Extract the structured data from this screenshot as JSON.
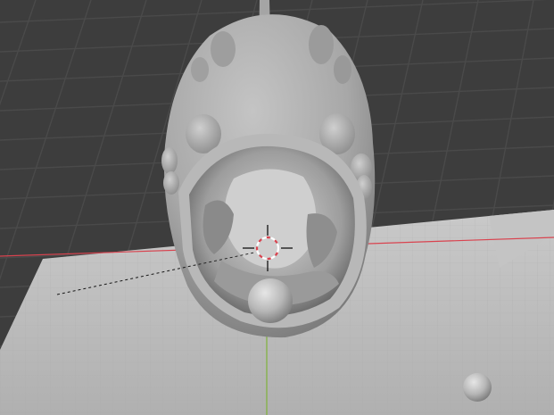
{
  "viewport": {
    "shading": "solid",
    "background_color": "#3d3d3d",
    "grid_line_color": "#4a4a4a",
    "x_axis_color": "#d9434f",
    "y_axis_color": "#7fb23a",
    "ground_plane_color": "#bdbdbd",
    "mesh_color": "#a9a9a9"
  },
  "scene": {
    "objects": [
      {
        "name": "sculpt-creature-mesh"
      },
      {
        "name": "ground-plane"
      },
      {
        "name": "small-sphere"
      },
      {
        "name": "sphere-in-mouth"
      }
    ],
    "cursor": {
      "icon": "3d-cursor-icon"
    }
  }
}
